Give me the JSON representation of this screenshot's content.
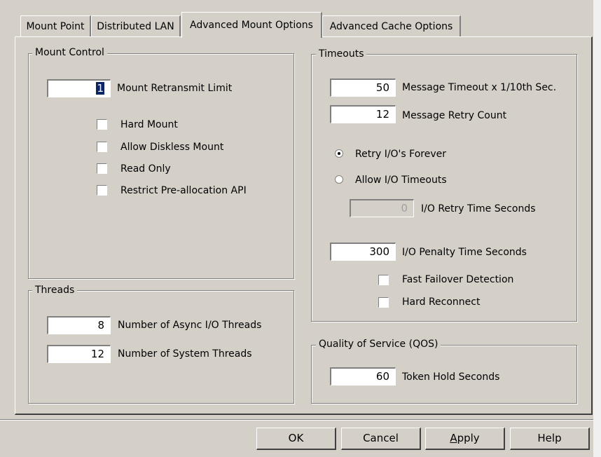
{
  "tabs": [
    "Mount Point",
    "Distributed LAN",
    "Advanced Mount Options",
    "Advanced Cache Options"
  ],
  "active_tab": "Advanced Mount Options",
  "mount_control": {
    "title": "Mount Control",
    "retransmit_value": "1",
    "retransmit_label": "Mount Retransmit Limit",
    "checkboxes": [
      "Hard Mount",
      "Allow Diskless Mount",
      "Read Only",
      "Restrict Pre-allocation API"
    ]
  },
  "threads": {
    "title": "Threads",
    "async_value": "8",
    "async_label": "Number of Async I/O Threads",
    "system_value": "12",
    "system_label": "Number of System Threads"
  },
  "timeouts": {
    "title": "Timeouts",
    "msg_timeout_value": "50",
    "msg_timeout_label": "Message Timeout x 1/10th Sec.",
    "msg_retry_value": "12",
    "msg_retry_label": "Message Retry Count",
    "radio_retry_forever": "Retry I/O's Forever",
    "radio_allow_timeouts": "Allow I/O Timeouts",
    "io_retry_value": "0",
    "io_retry_label": "I/O Retry Time Seconds",
    "io_penalty_value": "300",
    "io_penalty_label": "I/O Penalty Time Seconds",
    "fast_failover_label": "Fast Failover Detection",
    "hard_reconnect_label": "Hard Reconnect"
  },
  "qos": {
    "title": "Quality of Service (QOS)",
    "token_value": "60",
    "token_label": "Token Hold Seconds"
  },
  "buttons": {
    "ok": "OK",
    "cancel": "Cancel",
    "apply_prefix": "A",
    "apply_rest": "pply",
    "help": "Help"
  }
}
